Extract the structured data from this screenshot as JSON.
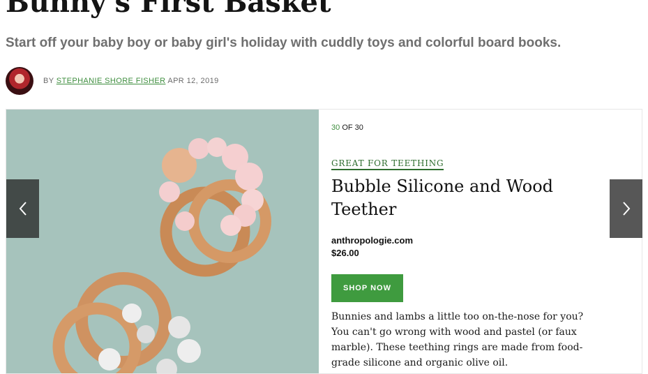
{
  "article": {
    "title": "Bunny's First Basket",
    "subtitle": "Start off your baby boy or baby girl's holiday with cuddly toys and colorful board books.",
    "byline_prefix": "BY",
    "author": "STEPHANIE SHORE FISHER",
    "date": "APR 12, 2019"
  },
  "slide": {
    "current": "30",
    "of_label": "OF",
    "total": "30",
    "category": "GREAT FOR TEETHING",
    "title": "Bubble Silicone and Wood Teether",
    "retailer": "anthropologie.com",
    "price": "$26.00",
    "button_label": "SHOP NOW",
    "description": "Bunnies and lambs a little too on-the-nose for you? You can't go wrong with wood and pastel (or faux marble). These teething rings are made from food-grade silicone and organic olive oil."
  },
  "icons": {
    "prev": "chevron-left-icon",
    "next": "chevron-right-icon"
  },
  "colors": {
    "accent": "#3f9b3f",
    "link": "#3f8e3f",
    "background": "#a8c4bd"
  }
}
